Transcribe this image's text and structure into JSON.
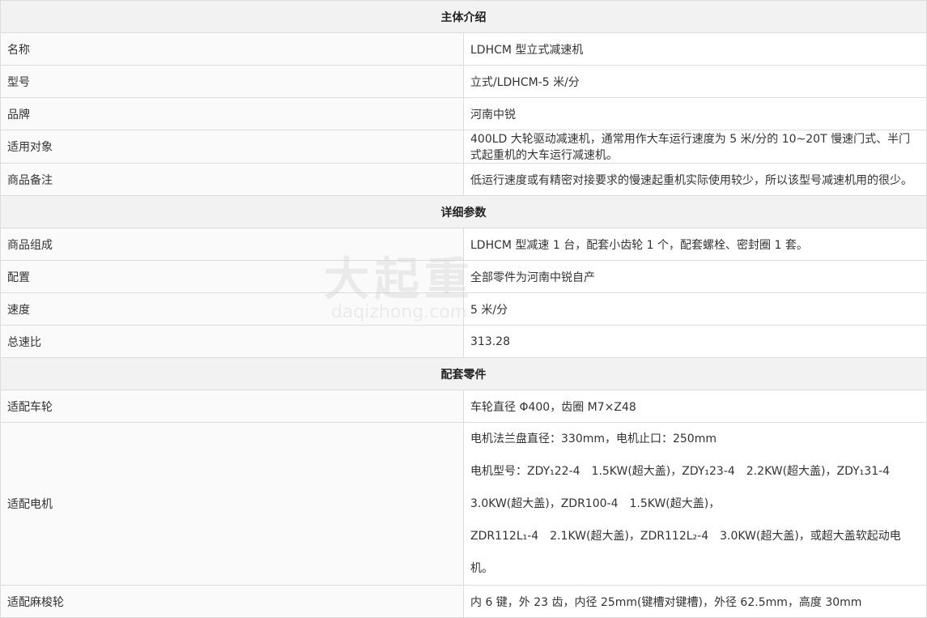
{
  "sections": {
    "intro": "主体介绍",
    "detail": "详细参数",
    "parts": "配套零件"
  },
  "intro_rows": [
    {
      "key": "名称",
      "value": "LDHCM 型立式减速机"
    },
    {
      "key": "型号",
      "value": "立式/LDHCM-5 米/分"
    },
    {
      "key": "品牌",
      "value": "河南中锐"
    },
    {
      "key": "适用对象",
      "value": "400LD 大轮驱动减速机，通常用作大车运行速度为 5 米/分的 10~20T 慢速门式、半门式起重机的大车运行减速机。"
    },
    {
      "key": "商品备注",
      "value": "低运行速度或有精密对接要求的慢速起重机实际使用较少，所以该型号减速机用的很少。"
    }
  ],
  "detail_rows": [
    {
      "key": "商品组成",
      "value": "LDHCM 型减速 1 台，配套小齿轮 1 个，配套螺栓、密封圈 1 套。"
    },
    {
      "key": "配置",
      "value": "全部零件为河南中锐自产"
    },
    {
      "key": "速度",
      "value": "5 米/分"
    },
    {
      "key": "总速比",
      "value": "313.28"
    }
  ],
  "parts_rows": [
    {
      "key": "适配车轮",
      "value": "车轮直径 Φ400，齿圈 M7×Z48"
    },
    {
      "key": "适配麻梭轮",
      "value": "内 6 键，外 23 齿，内径 25mm(键槽对键槽)，外径 62.5mm，高度 30mm"
    }
  ],
  "motor": {
    "key": "适配电机",
    "line1": "电机法兰盘直径：330mm，电机止口：250mm",
    "line2": "电机型号：ZDY₁22-4　1.5KW(超大盖)，ZDY₁23-4　2.2KW(超大盖)，ZDY₁31-4　3.0KW(超大盖)，ZDR100-4　1.5KW(超大盖)，",
    "line3": "ZDR112L₁-4　2.1KW(超大盖)，ZDR112L₂-4　3.0KW(超大盖)，或超大盖软起动电机。"
  },
  "watermark": {
    "cn": "大起重",
    "en": "daqizhong.com"
  }
}
